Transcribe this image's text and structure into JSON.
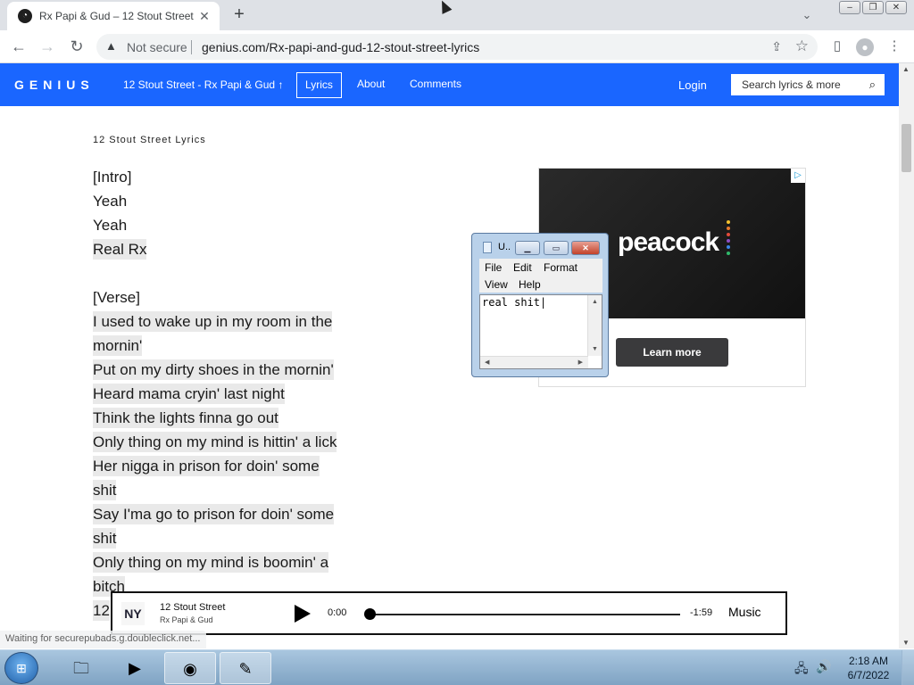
{
  "browser": {
    "tab_title": "Rx Papi & Gud – 12 Stout Street",
    "tab_close": "✕",
    "new_tab": "+",
    "tab_search": "⌄",
    "window_buttons": [
      "–",
      "❐",
      "✕"
    ],
    "back": "←",
    "forward": "→",
    "reload": "↻",
    "security_label": "Not secure",
    "url": "genius.com/Rx-papi-and-gud-12-stout-street-lyrics",
    "menu": "⋮"
  },
  "genius": {
    "logo": "GENIUS",
    "song_link": "12 Stout Street - Rx Papi & Gud",
    "nav": [
      "Lyrics",
      "About",
      "Comments"
    ],
    "login": "Login",
    "search_placeholder": "Search lyrics & more"
  },
  "lyrics": {
    "heading": "12 Stout Street Lyrics",
    "lines": [
      {
        "text": "[Intro]",
        "hl": false
      },
      {
        "text": "Yeah",
        "hl": false
      },
      {
        "text": "Yeah",
        "hl": false
      },
      {
        "text": "Real Rx",
        "hl": true
      },
      {
        "text": "",
        "hl": false
      },
      {
        "text": "[Verse]",
        "hl": false
      },
      {
        "text": "I used to wake up in my room in the",
        "hl": true
      },
      {
        "text": "mornin'",
        "hl": true
      },
      {
        "text": "Put on my dirty shoes in the mornin'",
        "hl": true
      },
      {
        "text": "Heard mama cryin' last night",
        "hl": true
      },
      {
        "text": "Think the lights finna go out",
        "hl": true
      },
      {
        "text": "Only thing on my mind is hittin' a lick",
        "hl": true
      },
      {
        "text": "Her nigga in prison for doin' some",
        "hl": true
      },
      {
        "text": "shit",
        "hl": true
      },
      {
        "text": "Say I'ma go to prison for doin' some",
        "hl": true
      },
      {
        "text": "shit",
        "hl": true
      },
      {
        "text": "Only thing on my mind is boomin' a",
        "hl": true
      },
      {
        "text": "bitch",
        "hl": true
      },
      {
        "text": "12",
        "hl": true
      }
    ]
  },
  "ad": {
    "brand": "peacock",
    "adchoices": "▷",
    "cta": "Learn more",
    "dot_colors": [
      "#f2c12e",
      "#e8792d",
      "#e24a3b",
      "#8c4ec4",
      "#3a86e8",
      "#2fb86a"
    ]
  },
  "notepad": {
    "title": "U..",
    "menu": [
      "File",
      "Edit",
      "Format",
      "View",
      "Help"
    ],
    "content": "real shit|"
  },
  "player": {
    "song": "12 Stout Street",
    "artist": "Rx Papi & Gud",
    "elapsed": "0:00",
    "remaining": "-1:59",
    "service": "Music",
    "progress": 0
  },
  "status": "Waiting for securepubads.g.doubleclick.net...",
  "taskbar": {
    "time": "2:18 AM",
    "date": "6/7/2022"
  }
}
